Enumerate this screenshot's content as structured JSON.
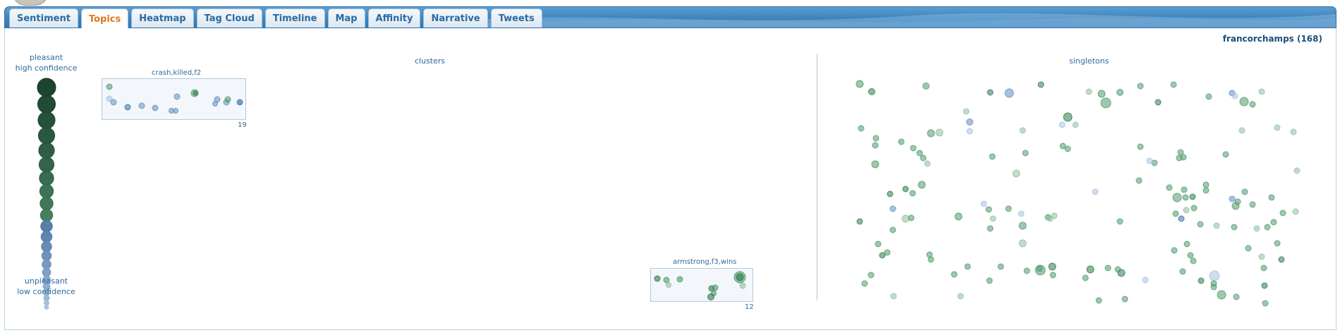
{
  "tabs": [
    {
      "label": "Sentiment",
      "active": false
    },
    {
      "label": "Topics",
      "active": true
    },
    {
      "label": "Heatmap",
      "active": false
    },
    {
      "label": "Tag Cloud",
      "active": false
    },
    {
      "label": "Timeline",
      "active": false
    },
    {
      "label": "Map",
      "active": false
    },
    {
      "label": "Affinity",
      "active": false
    },
    {
      "label": "Narrative",
      "active": false
    },
    {
      "label": "Tweets",
      "active": false
    }
  ],
  "dataset": {
    "title": "francorchamps (168)"
  },
  "legend": {
    "top_line1": "pleasant",
    "top_line2": "high confidence",
    "bottom_line1": "unpleasant",
    "bottom_line2": "low confidence"
  },
  "sections": {
    "clusters": "clusters",
    "singletons": "singletons"
  },
  "clusters": [
    {
      "label": "crash,killed,f2",
      "count": "19"
    },
    {
      "label": "armstrong,f3,wins",
      "count": "12"
    }
  ],
  "colors": {
    "accent_tab": "#e0791a",
    "tab_text": "#2c6aa0",
    "bar_blue": "#3e83bc",
    "pleasant": "#0f3b26",
    "mid_green": "#3f7a58",
    "blue": "#4f7fb0",
    "light_blue": "#a9c3de"
  }
}
